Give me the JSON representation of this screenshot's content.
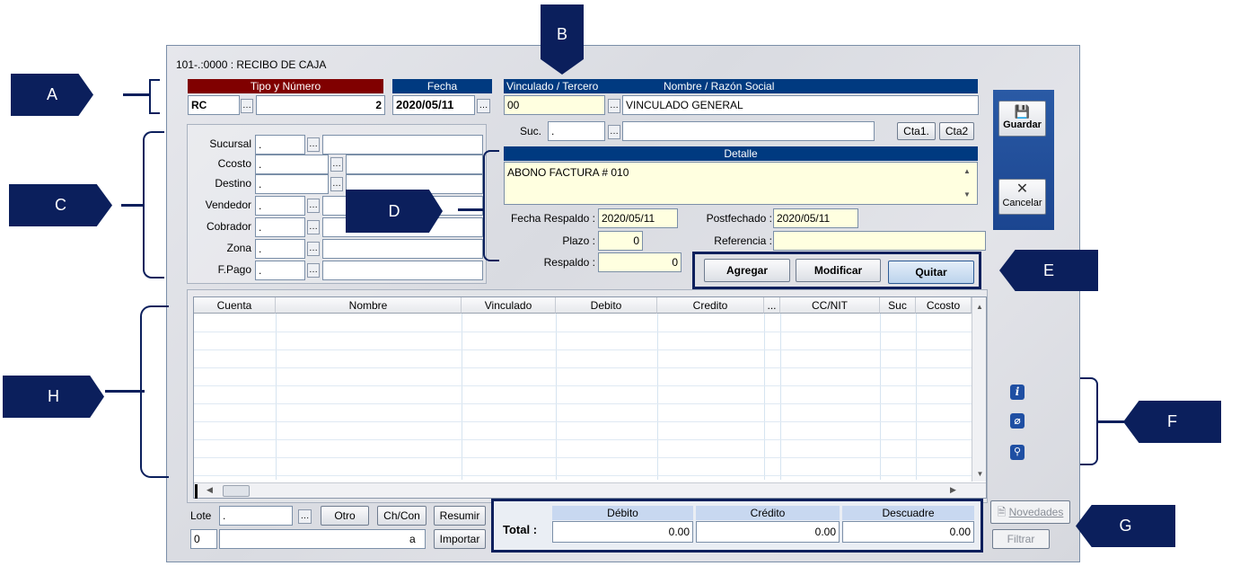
{
  "window": {
    "title": "101-.:0000 : RECIBO DE CAJA"
  },
  "callouts": {
    "a": "A",
    "b": "B",
    "c": "C",
    "d": "D",
    "e": "E",
    "f": "F",
    "g": "G",
    "h": "H"
  },
  "header": {
    "tipo_numero_label": "Tipo y Número",
    "tipo_value": "RC",
    "numero_value": "2",
    "fecha_label": "Fecha",
    "fecha_value": "2020/05/11",
    "vinculado_label": "Vinculado / Tercero",
    "nombre_label": "Nombre / Razón Social",
    "vinculado_value": "00",
    "nombre_value": "VINCULADO GENERAL",
    "suc_label": "Suc.",
    "suc_value": ".",
    "cta1_label": "Cta1.",
    "cta2_label": "Cta2"
  },
  "left_fields": [
    {
      "label": "Sucursal",
      "value": "."
    },
    {
      "label": "Ccosto",
      "value": "."
    },
    {
      "label": "Destino",
      "value": "."
    },
    {
      "label": "Vendedor",
      "value": "."
    },
    {
      "label": "Cobrador",
      "value": "."
    },
    {
      "label": "Zona",
      "value": "."
    },
    {
      "label": "F.Pago",
      "value": "."
    }
  ],
  "detalle": {
    "label": "Detalle",
    "text": "ABONO FACTURA # 010",
    "fecha_respaldo_label": "Fecha Respaldo :",
    "fecha_respaldo_value": "2020/05/11",
    "postfechado_label": "Postfechado :",
    "postfechado_value": "2020/05/11",
    "plazo_label": "Plazo :",
    "plazo_value": "0",
    "referencia_label": "Referencia :",
    "referencia_value": "",
    "respaldo_label": "Respaldo :",
    "respaldo_value": "0"
  },
  "actions": {
    "agregar": "Agregar",
    "modificar": "Modificar",
    "quitar": "Quitar"
  },
  "side": {
    "guardar": "Guardar",
    "cancelar": "Cancelar",
    "novedades": "Novedades",
    "filtrar": "Filtrar"
  },
  "grid": {
    "columns": [
      "Cuenta",
      "Nombre",
      "Vinculado",
      "Debito",
      "Credito",
      "...",
      "CC/NIT",
      "Suc",
      "Ccosto"
    ],
    "rows": []
  },
  "bottom": {
    "lote_label": "Lote",
    "lote_value": ".",
    "otro": "Otro",
    "chcon": "Ch/Con",
    "resumir": "Resumir",
    "importar": "Importar",
    "num_value": "0",
    "a_label": "a"
  },
  "totals": {
    "total_label": "Total :",
    "debito_label": "Débito",
    "credito_label": "Crédito",
    "descuadre_label": "Descuadre",
    "debito_value": "0.00",
    "credito_value": "0.00",
    "descuadre_value": "0.00"
  },
  "colors": {
    "header_navy": "#003a80",
    "header_red": "#800000",
    "callout_navy": "#0b1f5c",
    "input_yellow": "#ffffe0"
  }
}
